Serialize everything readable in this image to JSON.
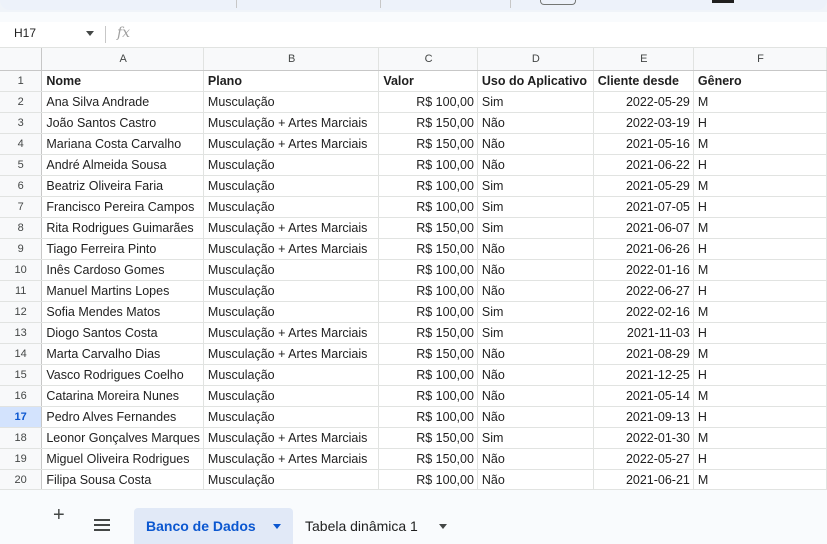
{
  "name_box": "H17",
  "fx_label": "fx",
  "columns": [
    "A",
    "B",
    "C",
    "D",
    "E",
    "F"
  ],
  "selected_row": 17,
  "header_row": {
    "row": "1",
    "cells": [
      "Nome",
      "Plano",
      "Valor",
      "Uso do Aplicativo",
      "Cliente desde",
      "Gênero"
    ]
  },
  "rows": [
    {
      "row": "2",
      "cells": [
        "Ana Silva Andrade",
        "Musculação",
        "R$ 100,00",
        "Sim",
        "2022-05-29",
        "M"
      ]
    },
    {
      "row": "3",
      "cells": [
        "João Santos Castro",
        "Musculação + Artes Marciais",
        "R$ 150,00",
        "Não",
        "2022-03-19",
        "H"
      ]
    },
    {
      "row": "4",
      "cells": [
        "Mariana Costa Carvalho",
        "Musculação + Artes Marciais",
        "R$ 150,00",
        "Não",
        "2021-05-16",
        "M"
      ]
    },
    {
      "row": "5",
      "cells": [
        "André Almeida Sousa",
        "Musculação",
        "R$ 100,00",
        "Não",
        "2021-06-22",
        "H"
      ]
    },
    {
      "row": "6",
      "cells": [
        "Beatriz Oliveira Faria",
        "Musculação",
        "R$ 100,00",
        "Sim",
        "2021-05-29",
        "M"
      ]
    },
    {
      "row": "7",
      "cells": [
        "Francisco Pereira Campos",
        "Musculação",
        "R$ 100,00",
        "Sim",
        "2021-07-05",
        "H"
      ]
    },
    {
      "row": "8",
      "cells": [
        "Rita Rodrigues Guimarães",
        "Musculação + Artes Marciais",
        "R$ 150,00",
        "Sim",
        "2021-06-07",
        "M"
      ]
    },
    {
      "row": "9",
      "cells": [
        "Tiago Ferreira Pinto",
        "Musculação + Artes Marciais",
        "R$ 150,00",
        "Não",
        "2021-06-26",
        "H"
      ]
    },
    {
      "row": "10",
      "cells": [
        "Inês Cardoso Gomes",
        "Musculação",
        "R$ 100,00",
        "Não",
        "2022-01-16",
        "M"
      ]
    },
    {
      "row": "11",
      "cells": [
        "Manuel Martins Lopes",
        "Musculação",
        "R$ 100,00",
        "Não",
        "2022-06-27",
        "H"
      ]
    },
    {
      "row": "12",
      "cells": [
        "Sofia Mendes Matos",
        "Musculação",
        "R$ 100,00",
        "Sim",
        "2022-02-16",
        "M"
      ]
    },
    {
      "row": "13",
      "cells": [
        "Diogo Santos Costa",
        "Musculação + Artes Marciais",
        "R$ 150,00",
        "Sim",
        "2021-11-03",
        "H"
      ]
    },
    {
      "row": "14",
      "cells": [
        "Marta Carvalho Dias",
        "Musculação + Artes Marciais",
        "R$ 150,00",
        "Não",
        "2021-08-29",
        "M"
      ]
    },
    {
      "row": "15",
      "cells": [
        "Vasco Rodrigues Coelho",
        "Musculação",
        "R$ 100,00",
        "Não",
        "2021-12-25",
        "H"
      ]
    },
    {
      "row": "16",
      "cells": [
        "Catarina Moreira Nunes",
        "Musculação",
        "R$ 100,00",
        "Não",
        "2021-05-14",
        "M"
      ]
    },
    {
      "row": "17",
      "cells": [
        "Pedro Alves Fernandes",
        "Musculação",
        "R$ 100,00",
        "Não",
        "2021-09-13",
        "H"
      ]
    },
    {
      "row": "18",
      "cells": [
        "Leonor Gonçalves Marques",
        "Musculação + Artes Marciais",
        "R$ 150,00",
        "Sim",
        "2022-01-30",
        "M"
      ]
    },
    {
      "row": "19",
      "cells": [
        "Miguel Oliveira Rodrigues",
        "Musculação + Artes Marciais",
        "R$ 150,00",
        "Não",
        "2022-05-27",
        "H"
      ]
    },
    {
      "row": "20",
      "cells": [
        "Filipa Sousa Costa",
        "Musculação",
        "R$ 100,00",
        "Não",
        "2021-06-21",
        "M"
      ]
    }
  ],
  "sheet_tabs": [
    {
      "label": "Banco de Dados",
      "active": true
    },
    {
      "label": "Tabela dinâmica 1",
      "active": false
    }
  ],
  "add_sheet_label": "+",
  "colors": {
    "accent": "#0b57d0",
    "active_tab_bg": "#e1e9f7",
    "selected_row_bg": "#d3e3fd"
  }
}
